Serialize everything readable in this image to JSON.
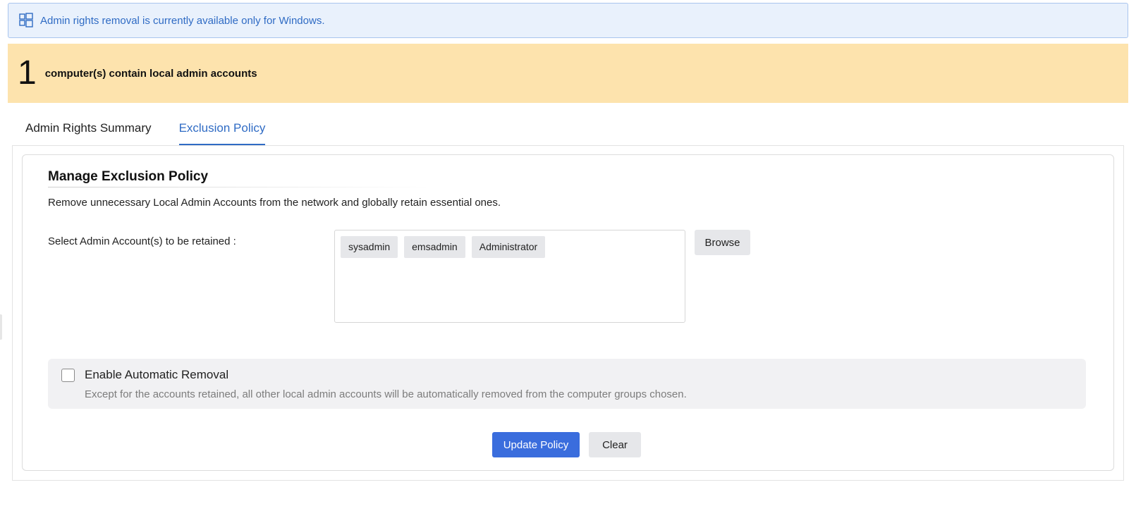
{
  "info_banner": {
    "icon": "windows-logo-icon",
    "text": "Admin rights removal is currently available only for Windows."
  },
  "summary_banner": {
    "count": "1",
    "label": "computer(s) contain local admin accounts"
  },
  "tabs": [
    {
      "label": "Admin Rights Summary",
      "active": false
    },
    {
      "label": "Exclusion Policy",
      "active": true
    }
  ],
  "policy": {
    "title": "Manage Exclusion Policy",
    "description": "Remove unnecessary Local Admin Accounts from the network and globally retain essential ones.",
    "retain_label": "Select Admin Account(s) to be retained :",
    "retained_accounts": [
      "sysadmin",
      "emsadmin",
      "Administrator"
    ],
    "browse_label": "Browse",
    "auto_removal": {
      "checked": false,
      "title": "Enable Automatic Removal",
      "description": "Except for the accounts retained, all other local admin accounts will be automatically removed from the computer groups chosen."
    },
    "update_label": "Update Policy",
    "clear_label": "Clear"
  },
  "colors": {
    "accent": "#3a6ddd",
    "info_text": "#2f6bc4",
    "info_background": "#e9f1fc",
    "warning_background": "#fde3ad"
  }
}
